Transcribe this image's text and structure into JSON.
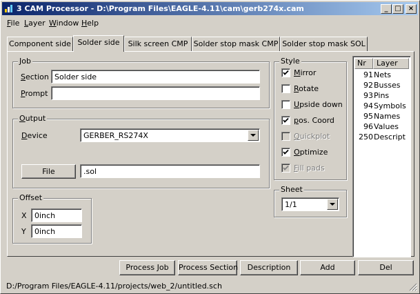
{
  "window": {
    "title": "3 CAM Processor - D:\\Program Files\\EAGLE-4.11\\cam\\gerb274x.cam",
    "controls": {
      "minimize": "_",
      "maximize": "□",
      "close": "×"
    }
  },
  "menu": [
    "File",
    "Layer",
    "Window",
    "Help"
  ],
  "tabs": [
    {
      "label": "Component side",
      "active": false
    },
    {
      "label": "Solder side",
      "active": true
    },
    {
      "label": "Silk screen CMP",
      "active": false
    },
    {
      "label": "Solder stop mask CMP",
      "active": false
    },
    {
      "label": "Solder stop mask SOL",
      "active": false
    }
  ],
  "job": {
    "group_label": "Job",
    "section_label": "Section",
    "section_value": "Solder side",
    "prompt_label": "Prompt",
    "prompt_value": ""
  },
  "output": {
    "group_label": "Output",
    "device_label": "Device",
    "device_value": "GERBER_RS274X",
    "file_button": "File",
    "file_value": ".sol"
  },
  "offset": {
    "group_label": "Offset",
    "x_label": "X",
    "x_value": "0inch",
    "y_label": "Y",
    "y_value": "0inch"
  },
  "style": {
    "group_label": "Style",
    "options": [
      {
        "label": "Mirror",
        "checked": true,
        "enabled": true
      },
      {
        "label": "Rotate",
        "checked": false,
        "enabled": true
      },
      {
        "label": "Upside down",
        "checked": false,
        "enabled": true
      },
      {
        "label": "pos. Coord",
        "checked": true,
        "enabled": true
      },
      {
        "label": "Quickplot",
        "checked": false,
        "enabled": false
      },
      {
        "label": "Optimize",
        "checked": true,
        "enabled": true
      },
      {
        "label": "Fill pads",
        "checked": true,
        "enabled": false
      }
    ]
  },
  "sheet": {
    "group_label": "Sheet",
    "value": "1/1"
  },
  "layers": {
    "col_nr": "Nr",
    "col_layer": "Layer",
    "rows": [
      {
        "nr": "91",
        "name": "Nets"
      },
      {
        "nr": "92",
        "name": "Busses"
      },
      {
        "nr": "93",
        "name": "Pins"
      },
      {
        "nr": "94",
        "name": "Symbols"
      },
      {
        "nr": "95",
        "name": "Names"
      },
      {
        "nr": "96",
        "name": "Values"
      },
      {
        "nr": "250",
        "name": "Descript"
      }
    ]
  },
  "buttons": {
    "process_job": "Process Job",
    "process_section": "Process Section",
    "description": "Description",
    "add": "Add",
    "del": "Del"
  },
  "status": "D:/Program Files/EAGLE-4.11/projects/web_2/untitled.sch"
}
